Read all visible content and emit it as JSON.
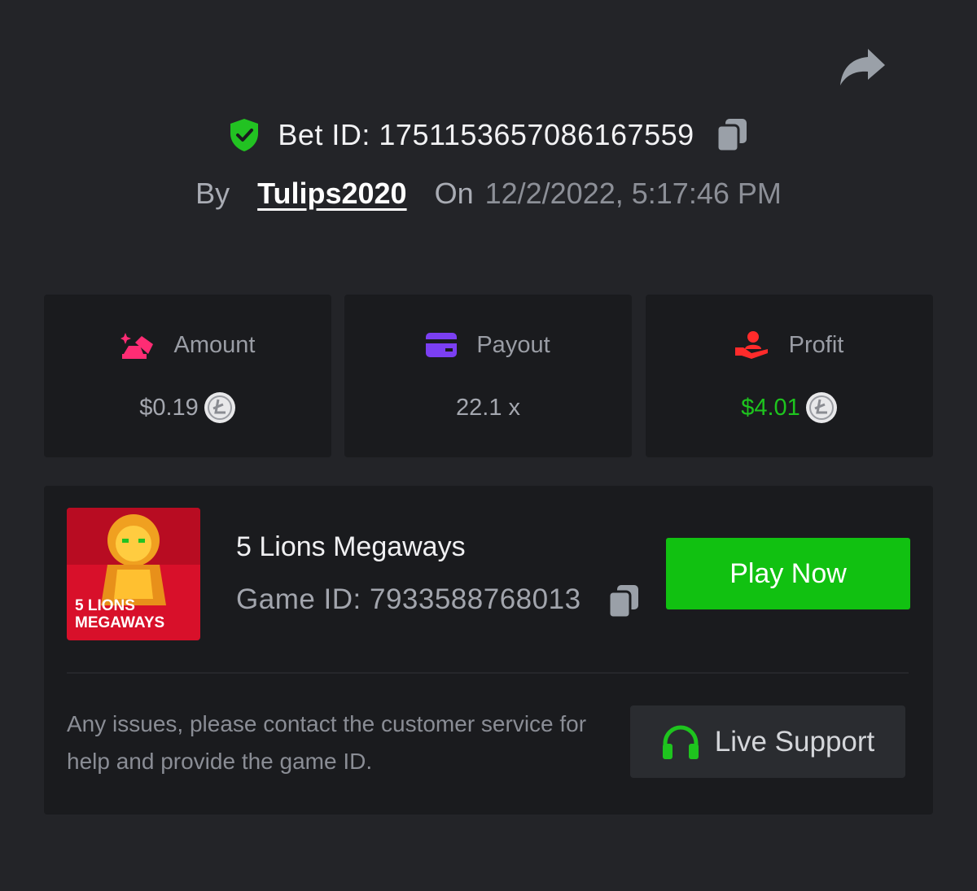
{
  "header": {
    "bet_id_label": "Bet ID:",
    "bet_id": "1751153657086167559",
    "bet_id_text": "Bet ID: 1751153657086167559",
    "by_label": "By",
    "username": "Tulips2020",
    "on_label": "On",
    "datetime": "12/2/2022, 5:17:46 PM"
  },
  "stats": {
    "amount": {
      "label": "Amount",
      "value": "$0.19",
      "icon": "gold-bars-icon",
      "currency_icon": "litecoin-icon"
    },
    "payout": {
      "label": "Payout",
      "value": "22.1 x",
      "icon": "card-icon"
    },
    "profit": {
      "label": "Profit",
      "value": "$4.01",
      "icon": "hand-user-icon",
      "currency_icon": "litecoin-icon"
    }
  },
  "game": {
    "title": "5 Lions Megaways",
    "game_id_label": "Game ID:",
    "game_id": "7933588768013",
    "game_id_text": "Game ID: 7933588768013",
    "thumb_text_line1": "5 LIONS",
    "thumb_text_line2": "MEGAWAYS",
    "play_button": "Play Now"
  },
  "support": {
    "notice": "Any issues, please contact the customer service for help and provide the game ID.",
    "button": "Live Support",
    "icon": "headphones-icon"
  },
  "colors": {
    "background": "#232428",
    "card": "#1a1b1e",
    "accent_green": "#11c111",
    "profit_green": "#1ec41e",
    "shield_green": "#22c222",
    "amount_pink": "#ff2c74",
    "payout_purple": "#7b3ff2",
    "profit_red": "#ff2b2b"
  }
}
